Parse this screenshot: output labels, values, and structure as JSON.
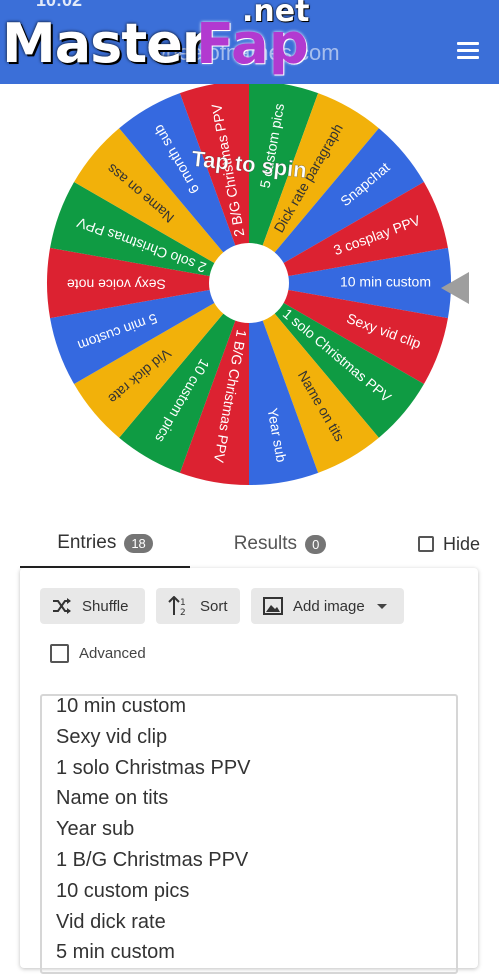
{
  "header": {
    "status_time": "10:02",
    "site_url": "wheelofnames.com",
    "watermark_main": "Master",
    "watermark_fap": "Fap",
    "watermark_net": ".net",
    "menu_icon": "hamburger-menu-icon"
  },
  "wheel": {
    "center_text": "Tap to spin",
    "colors": [
      "#3569e0",
      "#dc2231",
      "#0f9b43",
      "#f2b10a"
    ],
    "segments": [
      "10 min custom",
      "Sexy vid clip",
      "1 solo Christmas PPV",
      "Name on tits",
      "Year sub",
      "1 B/G Christmas PPV",
      "10 custom pics",
      "Vid dick rate",
      "5 min custom",
      "Sexy voice note",
      "2 solo Christmas PPV",
      "Name on ass",
      "6 month sub",
      "2 B/G Christmas PPV",
      "5 custom pics",
      "Dick rate paragraph",
      "Snapchat",
      "3 cosplay PPV"
    ]
  },
  "tabs": {
    "entries_label": "Entries",
    "entries_count": "18",
    "results_label": "Results",
    "results_count": "0",
    "hide_label": "Hide"
  },
  "toolbar": {
    "shuffle_label": "Shuffle",
    "sort_label": "Sort",
    "add_image_label": "Add image",
    "advanced_label": "Advanced"
  },
  "entries_list": [
    "10 min custom",
    "Sexy vid clip",
    "1 solo Christmas PPV",
    "Name on tits",
    "Year sub",
    "1 B/G Christmas PPV",
    "10 custom pics",
    "Vid dick rate",
    "5 min custom"
  ]
}
